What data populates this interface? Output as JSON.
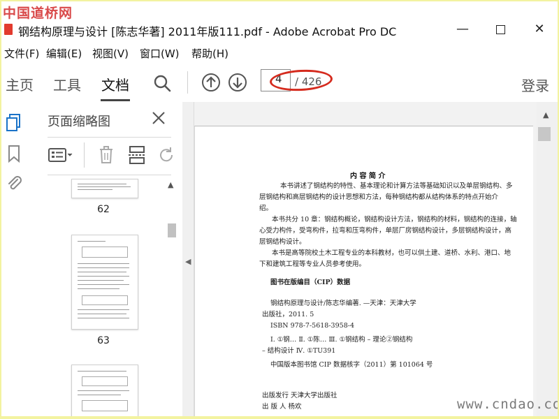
{
  "watermark_top": "中国道桥网",
  "watermark_bottom": "www.cndao.com",
  "window": {
    "title": "钢结构原理与设计 [陈志华著] 2011年版111.pdf - Adobe Acrobat Pro DC"
  },
  "menu": [
    {
      "label": "文件(F)"
    },
    {
      "label": "编辑(E)"
    },
    {
      "label": "视图(V)"
    },
    {
      "label": "窗口(W)"
    },
    {
      "label": "帮助(H)"
    }
  ],
  "toolbar": {
    "tabs": [
      {
        "label": "主页"
      },
      {
        "label": "工具"
      },
      {
        "label": "文档"
      }
    ],
    "page_current": "4",
    "page_total": "/ 426",
    "login": "登录"
  },
  "thumbnails": {
    "title": "页面缩略图",
    "pages": [
      {
        "label": "62"
      },
      {
        "label": "63"
      }
    ]
  },
  "document": {
    "heading": "内 容 简 介",
    "lines": [
      "本书讲述了钢结构的特性、基本理论和计算方法等基础知识以及单层钢结构、多",
      "层钢结构和高层钢结构的设计思想和方法，每种钢结构都从结构体系的特点开始介",
      "绍。",
      "本书共分 10 章：钢结构概论，钢结构设计方法，钢结构的材料，钢结构的连接，轴",
      "心受力构件，受弯构件，拉弯和压弯构件，单层厂房钢结构设计，多层钢结构设计，高",
      "层钢结构设计。",
      "本书是高等院校土木工程专业的本科教材，也可以供土建、道桥、水利、港口、地",
      "下和建筑工程等专业人员参考使用。"
    ],
    "cip_title": "图书在版编目（CIP）数据",
    "cip_lines": [
      "钢结构原理与设计/陈志华编著. —天津：天津大学",
      "出版社，2011. 5",
      "ISBN 978-7-5618-3958-4",
      "Ⅰ. ①钢…   Ⅱ. ①陈…   Ⅲ. ①钢结构 – 理论②钢结构",
      "– 结构设计   Ⅳ. ①TU391",
      "中国版本图书馆 CIP 数据核字（2011）第 101064 号"
    ],
    "pub_lines": [
      "出版发行   天津大学出版社",
      "出  版  人    杨欢"
    ]
  },
  "colors": {
    "highlight_ellipse": "#d52b1e",
    "outer_border": "#f3f3a0"
  }
}
